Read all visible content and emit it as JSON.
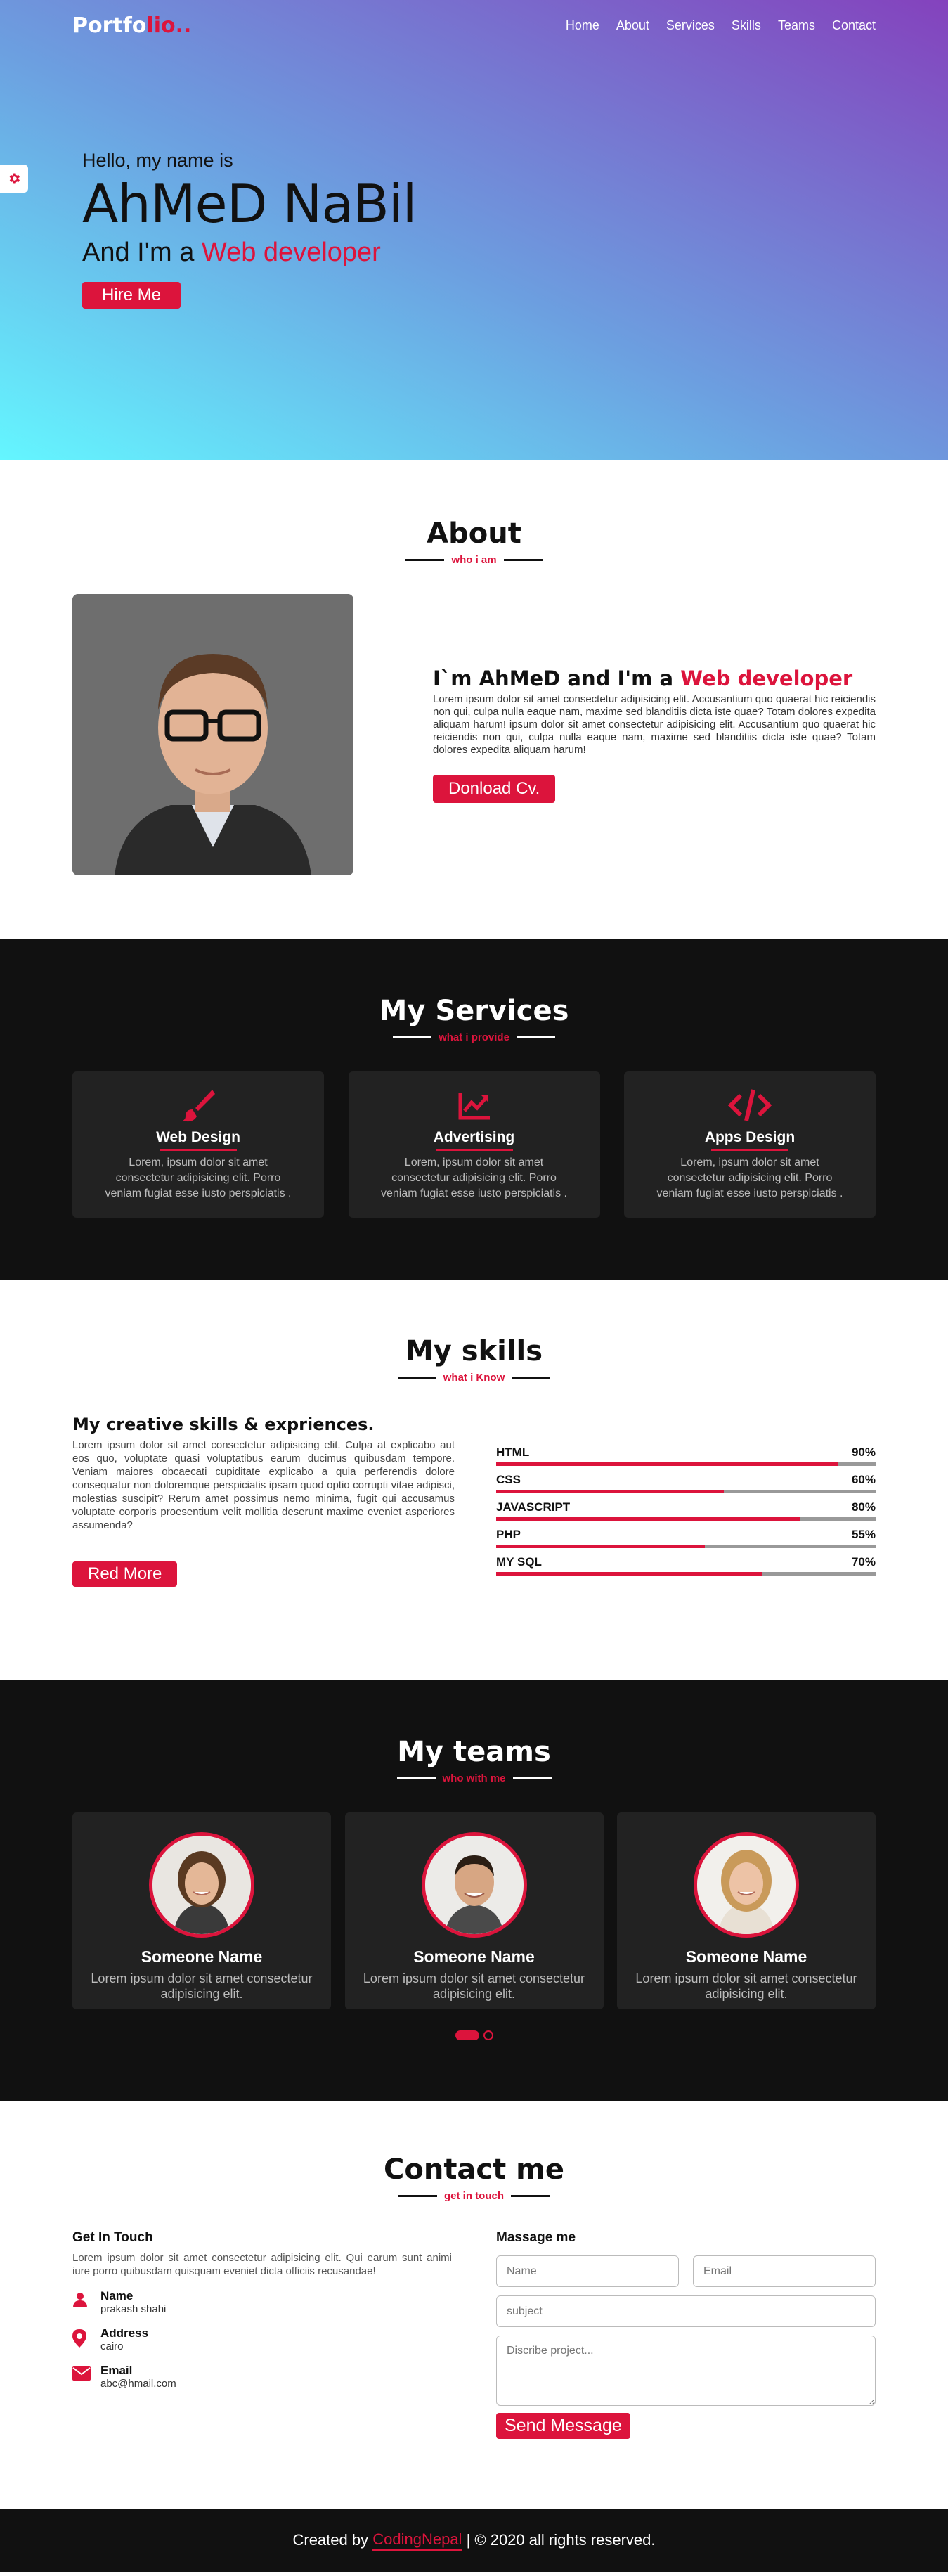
{
  "nav": {
    "logo_main": "Portfo",
    "logo_accent": "lio..",
    "items": [
      "Home",
      "About",
      "Services",
      "Skills",
      "Teams",
      "Contact"
    ]
  },
  "home": {
    "greeting": "Hello, my name is",
    "name": "AhMeD NaBil",
    "role_prefix": "And I'm a",
    "role": "Web developer",
    "cta": "Hire Me"
  },
  "about": {
    "title": "About",
    "subtitle": "who i am",
    "heading_prefix": "I`m AhMeD and I'm a",
    "heading_accent": "Web developer",
    "text": "Lorem ipsum dolor sit amet consectetur adipisicing elit. Accusantium quo quaerat hic reiciendis non qui, culpa nulla eaque nam, maxime sed blanditiis dicta iste quae? Totam dolores expedita aliquam harum! ipsum dolor sit amet consectetur adipisicing elit. Accusantium quo quaerat hic reiciendis non qui, culpa nulla eaque nam, maxime sed blanditiis dicta iste quae? Totam dolores expedita aliquam harum!",
    "cta": "Donload Cv."
  },
  "services": {
    "title": "My Services",
    "subtitle": "what i provide",
    "cards": [
      {
        "name": "Web Design",
        "icon": "paint-brush-icon",
        "desc": "Lorem, ipsum dolor sit amet consectetur adipisicing elit. Porro veniam fugiat esse iusto perspiciatis ."
      },
      {
        "name": "Advertising",
        "icon": "chart-line-icon",
        "desc": "Lorem, ipsum dolor sit amet consectetur adipisicing elit. Porro veniam fugiat esse iusto perspiciatis ."
      },
      {
        "name": "Apps Design",
        "icon": "code-icon",
        "desc": "Lorem, ipsum dolor sit amet consectetur adipisicing elit. Porro veniam fugiat esse iusto perspiciatis ."
      }
    ]
  },
  "skills": {
    "title": "My skills",
    "subtitle": "what i Know",
    "heading": "My creative skills & expriences.",
    "text": "Lorem ipsum dolor sit amet consectetur adipisicing elit. Culpa at explicabo aut eos quo, voluptate quasi voluptatibus earum ducimus quibusdam tempore. Veniam maiores obcaecati cupiditate explicabo a quia perferendis dolore consequatur non doloremque perspiciatis ipsam quod optio corrupti vitae adipisci, molestias suscipit? Rerum amet possimus nemo minima, fugit qui accusamus voluptate corporis proesentium velit mollitia deserunt maxime eveniet asperiores assumenda?",
    "cta": "Red More",
    "bars": [
      {
        "name": "HTML",
        "percent_label": "90%",
        "level": 0.9
      },
      {
        "name": "CSS",
        "percent_label": "60%",
        "level": 0.6
      },
      {
        "name": "JAVASCRIPT",
        "percent_label": "80%",
        "level": 0.8
      },
      {
        "name": "PHP",
        "percent_label": "55%",
        "level": 0.55
      },
      {
        "name": "MY SQL",
        "percent_label": "70%",
        "level": 0.7
      }
    ]
  },
  "teams": {
    "title": "My teams",
    "subtitle": "who with me",
    "members": [
      {
        "name": "Someone Name",
        "desc": "Lorem ipsum dolor sit amet consectetur adipisicing elit."
      },
      {
        "name": "Someone Name",
        "desc": "Lorem ipsum dolor sit amet consectetur adipisicing elit."
      },
      {
        "name": "Someone Name",
        "desc": "Lorem ipsum dolor sit amet consectetur adipisicing elit."
      }
    ]
  },
  "contact": {
    "title": "Contact me",
    "subtitle": "get in touch",
    "left_heading": "Get In Touch",
    "left_text": "Lorem ipsum dolor sit amet consectetur adipisicing elit. Qui earum sunt animi iure porro quibusdam quisquam eveniet dicta officiis recusandae!",
    "rows": [
      {
        "label": "Name",
        "value": "prakash shahi",
        "icon": "user-icon"
      },
      {
        "label": "Address",
        "value": "cairo",
        "icon": "map-marker-icon"
      },
      {
        "label": "Email",
        "value": "abc@hmail.com",
        "icon": "envelope-icon"
      }
    ],
    "right_heading": "Massage me",
    "name_placeholder": "Name",
    "email_placeholder": "Email",
    "subject_placeholder": "subject",
    "message_placeholder": "Discribe project...",
    "cta": "Send Message"
  },
  "footer": {
    "prefix": "Created by",
    "link": "CodingNepal",
    "suffix": "| © 2020 all rights reserved."
  },
  "colors": {
    "accent": "#dc143c",
    "dark": "#111111",
    "card": "#222222"
  }
}
